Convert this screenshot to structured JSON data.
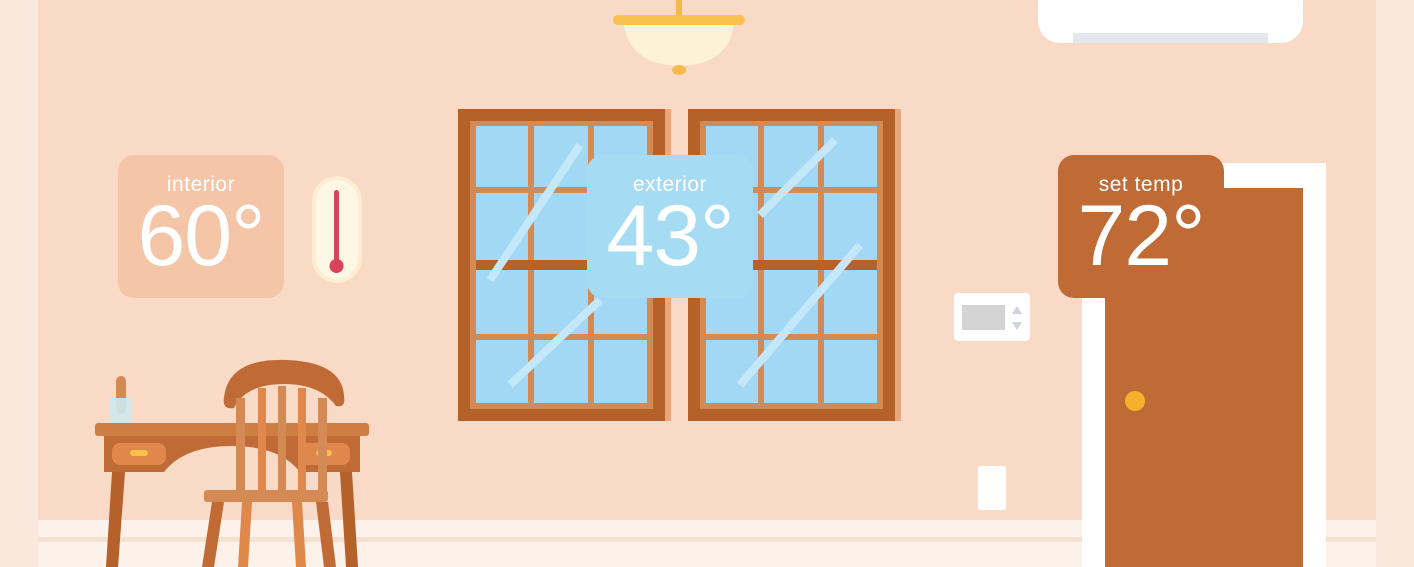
{
  "scene": {
    "colors": {
      "wall": "#f8dac6",
      "interior_card": "#f5c5a8",
      "exterior_card": "#a6dbf4",
      "set_temp_card": "#c06a36",
      "window_frame": "#b5612a",
      "glass": "#a2d8f4",
      "door": "#c06a36",
      "thermometer_red": "#d9435b"
    },
    "icons": [
      "thermometer-icon",
      "ceiling-lamp-icon",
      "air-conditioner-icon",
      "thermostat-icon",
      "light-switch-icon"
    ]
  },
  "cards": {
    "interior": {
      "label": "interior",
      "value": "60°"
    },
    "exterior": {
      "label": "exterior",
      "value": "43°"
    },
    "set_temp": {
      "label": "set temp",
      "value": "72°"
    }
  }
}
